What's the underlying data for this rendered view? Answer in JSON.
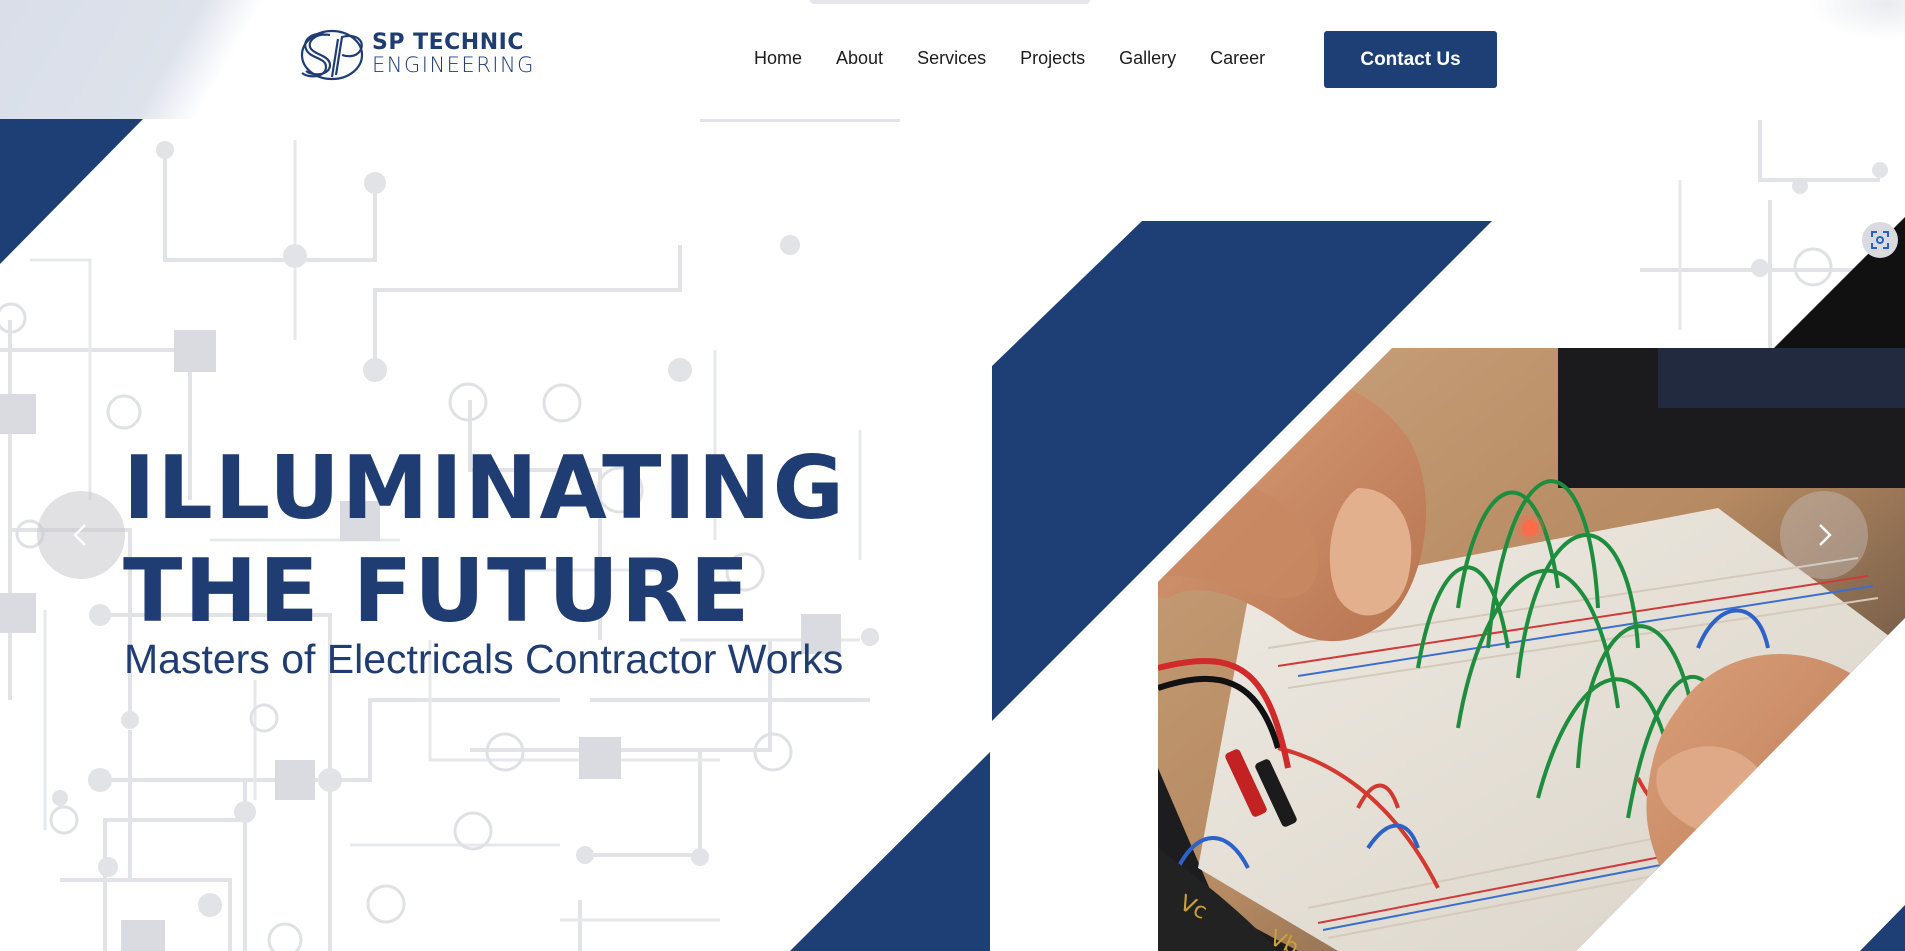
{
  "header": {
    "logo": {
      "line1": "SP TECHNIC",
      "line2": "ENGINEERING",
      "monogram": "SP"
    },
    "nav": [
      {
        "label": "Home"
      },
      {
        "label": "About"
      },
      {
        "label": "Services"
      },
      {
        "label": "Projects"
      },
      {
        "label": "Gallery"
      },
      {
        "label": "Career"
      }
    ],
    "contact_label": "Contact Us"
  },
  "hero": {
    "title_line1": "ILLUMINATING",
    "title_line2": "THE FUTURE",
    "subtitle": "Masters of Electricals Contractor Works"
  },
  "icons": {
    "prev": "chevron-left-icon",
    "next": "chevron-right-icon",
    "scan": "scan-icon"
  },
  "colors": {
    "brand_navy": "#1e3f76",
    "text_dark": "#1c1c1c",
    "circuit_gray": "#d4d6da"
  }
}
